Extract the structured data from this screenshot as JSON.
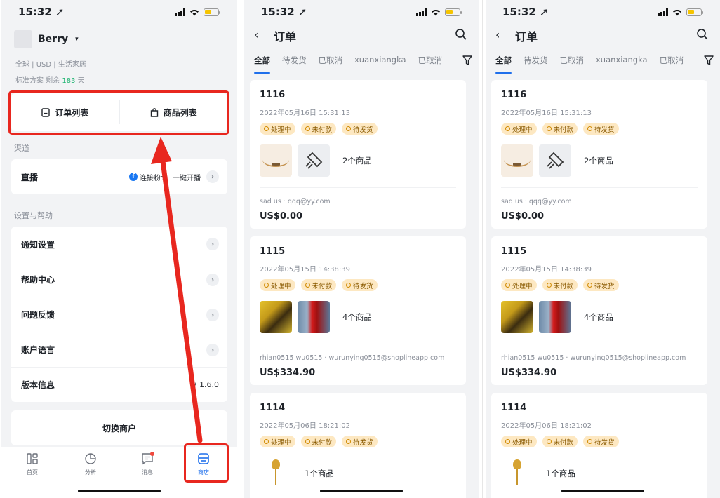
{
  "status": {
    "time": "15:32 ➚"
  },
  "store": {
    "merchant": "Berry",
    "meta": "全球 | USD | 生活家居",
    "plan_prefix": "标准方案 剩余",
    "plan_days": "183",
    "plan_suffix": "天",
    "quick": {
      "orders": "订单列表",
      "products": "商品列表"
    },
    "channel_title": "渠道",
    "live": {
      "label": "直播",
      "connect": "连接粉专",
      "start": "一键开播"
    },
    "settings_title": "设置与帮助",
    "settings": [
      "通知设置",
      "帮助中心",
      "问题反馈",
      "账户语言"
    ],
    "version": {
      "label": "版本信息",
      "value": "V 1.6.0"
    },
    "switch": "切换商户",
    "tabs": {
      "home": "首页",
      "analytics": "分析",
      "messages": "消息",
      "shop": "商店"
    }
  },
  "orders_page": {
    "title": "订单",
    "filters": [
      "全部",
      "待发货",
      "已取消",
      "xuanxiangka",
      "已取消"
    ],
    "tags": [
      "处理中",
      "未付款",
      "待发货"
    ],
    "orders": [
      {
        "id": "1116",
        "date": "2022年05月16日 15:31:13",
        "count": "2个商品",
        "buyer": "sad us · qqq@yy.com",
        "total": "US$0.00"
      },
      {
        "id": "1115",
        "date": "2022年05月15日 14:38:39",
        "count": "4个商品",
        "buyer": "rhian0515 wu0515 · wurunying0515@shoplineapp.com",
        "total": "US$334.90"
      },
      {
        "id": "1114",
        "date": "2022年05月06日 18:21:02",
        "count": "1个商品",
        "buyer": "",
        "total": ""
      }
    ]
  },
  "colors": {
    "accent": "#1f6feb",
    "highlight": "#e8271f",
    "tag_bg": "#fde8c2",
    "days": "#22b573"
  }
}
